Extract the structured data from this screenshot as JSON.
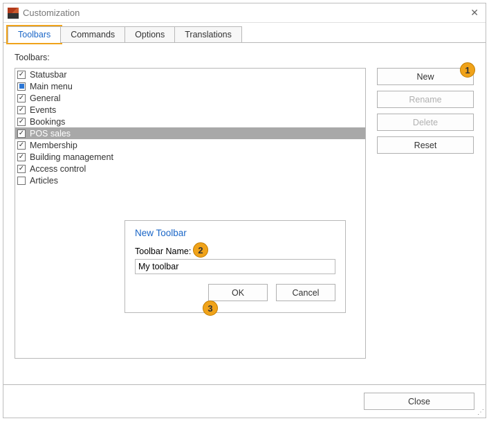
{
  "window": {
    "title": "Customization"
  },
  "tabs": [
    {
      "label": "Toolbars",
      "active": true,
      "highlighted": true
    },
    {
      "label": "Commands"
    },
    {
      "label": "Options"
    },
    {
      "label": "Translations"
    }
  ],
  "section_label": "Toolbars:",
  "toolbars": [
    {
      "label": "Statusbar",
      "state": "checked"
    },
    {
      "label": "Main menu",
      "state": "filled"
    },
    {
      "label": "General",
      "state": "checked"
    },
    {
      "label": "Events",
      "state": "checked"
    },
    {
      "label": "Bookings",
      "state": "checked"
    },
    {
      "label": "POS sales",
      "state": "checked",
      "selected": true
    },
    {
      "label": "Membership",
      "state": "checked"
    },
    {
      "label": "Building management",
      "state": "checked"
    },
    {
      "label": "Access control",
      "state": "checked"
    },
    {
      "label": "Articles",
      "state": "unchecked"
    }
  ],
  "buttons": {
    "new": "New",
    "rename": "Rename",
    "delete": "Delete",
    "reset": "Reset",
    "close": "Close"
  },
  "dialog": {
    "title": "New Toolbar",
    "field_label": "Toolbar Name:",
    "value": "My toolbar",
    "ok": "OK",
    "cancel": "Cancel"
  },
  "callouts": {
    "c1": "1",
    "c2": "2",
    "c3": "3"
  }
}
